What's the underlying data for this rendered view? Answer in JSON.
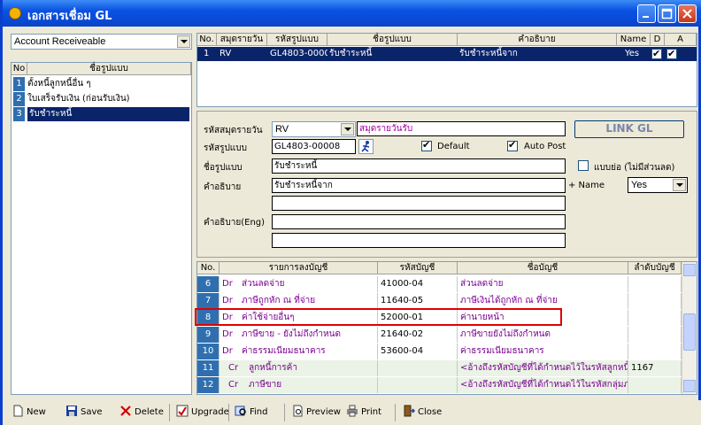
{
  "window": {
    "title": "เอกสารเชื่อม GL"
  },
  "left": {
    "doc_type": "Account Receiveable",
    "list_headers": {
      "no": "No",
      "name": "ชื่อรูปแบบ"
    },
    "items": [
      {
        "no": "1",
        "name": "ตั้งหนี้ลูกหนี้อื่น ๆ"
      },
      {
        "no": "2",
        "name": "ใบเสร็จรับเงิน (ก่อนรับเงิน)"
      },
      {
        "no": "3",
        "name": "รับชำระหนี้"
      }
    ]
  },
  "top_grid": {
    "headers": {
      "no": "No.",
      "journal": "สมุดรายวัน",
      "code": "รหัสรูปแบบ",
      "name": "ชื่อรูปแบบ",
      "desc": "คำอธิบาย",
      "name_col": "Name",
      "d": "D",
      "a": "A"
    },
    "rows": [
      {
        "no": "1",
        "journal": "RV",
        "code": "GL4803-0000",
        "name": "รับชำระหนี้",
        "desc": "รับชำระหนี้จาก",
        "name_val": "Yes",
        "d": true,
        "a": true
      }
    ]
  },
  "form": {
    "journal_label": "รหัสสมุดรายวัน",
    "journal_value": "RV",
    "journal_name": "สมุดรายวันรับ",
    "link_gl": "LINK GL",
    "code_label": "รหัสรูปแบบ",
    "code_value": "GL4803-00008",
    "default_label": "Default",
    "autopost_label": "Auto Post",
    "name_label": "ชื่อรูปแบบ",
    "name_value": "รับชำระหนี้",
    "breakdown_label": "แบบย่อ (ไม่มีส่วนลด)",
    "desc_label": "คำอธิบาย",
    "desc_value": "รับชำระหนี้จาก",
    "plus_name_label": "+ Name",
    "plus_name_value": "Yes",
    "desc_eng_label": "คำอธิบาย(Eng)"
  },
  "acct_grid": {
    "headers": {
      "no": "No.",
      "entry": "รายการลงบัญชี",
      "acct_code": "รหัสบัญชี",
      "acct_name": "ชื่อบัญชี",
      "order": "ลำดับบัญชี"
    },
    "rows": [
      {
        "no": "6",
        "side": "Dr",
        "entry": "ส่วนลดจ่าย",
        "acct_code": "41000-04",
        "acct_name": "ส่วนลดจ่าย",
        "order": ""
      },
      {
        "no": "7",
        "side": "Dr",
        "entry": "ภาษีถูกหัก ณ ที่จ่าย",
        "acct_code": "11640-05",
        "acct_name": "ภาษีเงินได้ถูกหัก ณ ที่จ่าย",
        "order": ""
      },
      {
        "no": "8",
        "side": "Dr",
        "entry": "ค่าใช้จ่ายอื่นๆ",
        "acct_code": "52000-01",
        "acct_name": "ค่านายหน้า",
        "order": ""
      },
      {
        "no": "9",
        "side": "Dr",
        "entry": "ภาษีขาย - ยังไม่ถึงกำหนด",
        "acct_code": "21640-02",
        "acct_name": "ภาษีขายยังไม่ถึงกำหนด",
        "order": ""
      },
      {
        "no": "10",
        "side": "Dr",
        "entry": "ค่าธรรมเนียมธนาคาร",
        "acct_code": "53600-04",
        "acct_name": "ค่าธรรมเนียมธนาคาร",
        "order": ""
      },
      {
        "no": "11",
        "side": "Cr",
        "entry": "ลูกหนี้การค้า",
        "acct_code": "",
        "acct_name": "<อ้างถึงรหัสบัญชีที่ได้กำหนดไว้ในรหัสลูกหนี้>",
        "order": "1167"
      },
      {
        "no": "12",
        "side": "Cr",
        "entry": "ภาษีขาย",
        "acct_code": "",
        "acct_name": "<อ้างถึงรหัสบัญชีที่ได้กำหนดไว้ในรหัสกลุ่มภาษี>",
        "order": ""
      }
    ]
  },
  "toolbar": {
    "new": "New",
    "save": "Save",
    "delete": "Delete",
    "upgrade": "Upgrade",
    "find": "Find",
    "preview": "Preview",
    "print": "Print",
    "close": "Close"
  },
  "colors": {
    "title_bar": "#0a52e3",
    "selected_row": "#0a246a",
    "highlight_box": "#e00000",
    "entry_text": "#7a0090"
  }
}
